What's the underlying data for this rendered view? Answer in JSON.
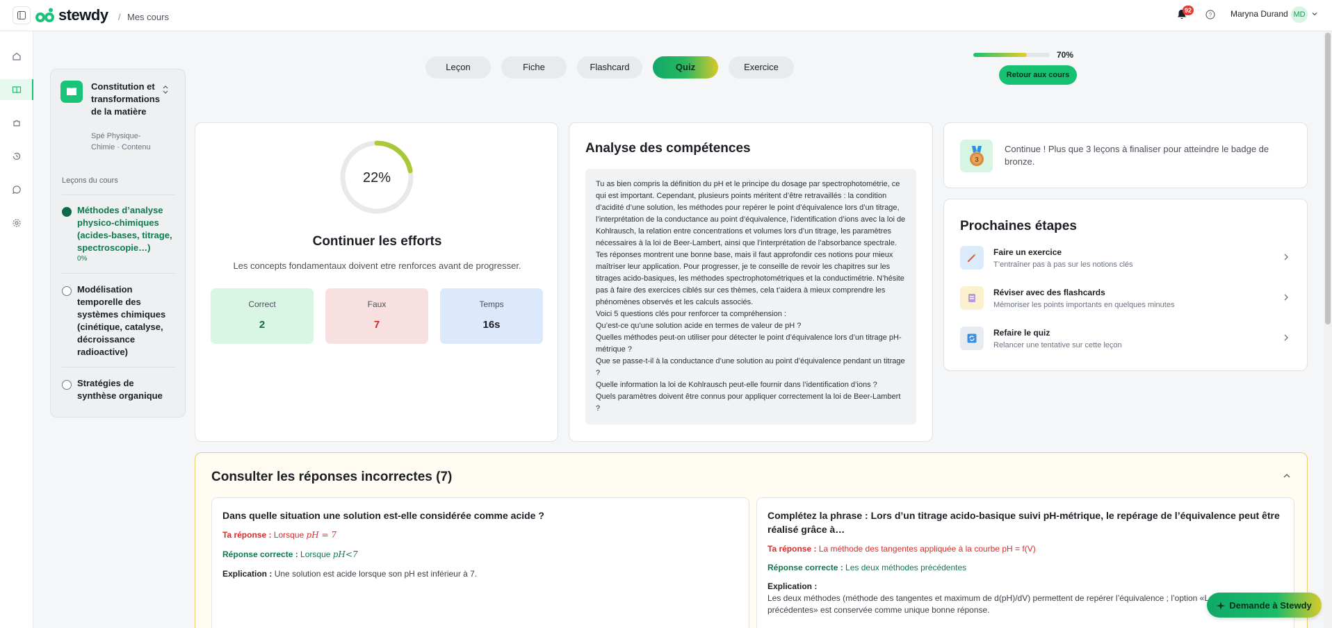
{
  "header": {
    "app_name": "stewdy",
    "breadcrumb_separator": "/",
    "breadcrumb": "Mes cours",
    "notifications_count": "92",
    "user_name": "Maryna Durand",
    "user_initials": "MD"
  },
  "rail": {
    "items": [
      "home-icon",
      "book-icon",
      "puzzle-icon",
      "history-icon",
      "chat-icon",
      "settings-icon"
    ],
    "active_index": 1
  },
  "course": {
    "title": "Constitution et transformations de la matière",
    "subtitle": "Spé Physique-Chimie · Contenu",
    "lessons_label": "Leçons du cours",
    "lessons": [
      {
        "title": "Méthodes d’analyse physico-chimiques (acides-bases, titrage, spectroscopie…)",
        "progress": "0%",
        "active": true
      },
      {
        "title": "Modélisation temporelle des systèmes chimiques (cinétique, catalyse, décroissance radioactive)",
        "active": false
      },
      {
        "title": "Stratégies de synthèse organique",
        "active": false
      }
    ]
  },
  "tabs": [
    {
      "label": "Leçon"
    },
    {
      "label": "Fiche"
    },
    {
      "label": "Flashcard"
    },
    {
      "label": "Quiz",
      "active": true
    },
    {
      "label": "Exercice"
    }
  ],
  "progress": {
    "value": 0.7,
    "label": "70%",
    "back_label": "Retour aux cours"
  },
  "score": {
    "percent_value": 0.22,
    "percent_label": "22%",
    "title": "Continuer les efforts",
    "description": "Les concepts fondamentaux doivent etre renforces avant de progresser.",
    "stats": {
      "correct_label": "Correct",
      "correct_value": "2",
      "wrong_label": "Faux",
      "wrong_value": "7",
      "time_label": "Temps",
      "time_value": "16s"
    }
  },
  "analysis": {
    "title": "Analyse des compétences",
    "paragraph": "Tu as bien compris la définition du pH et le principe du dosage par spectrophotométrie, ce qui est important. Cependant, plusieurs points méritent d’être retravaillés : la condition d’acidité d’une solution, les méthodes pour repérer le point d’équivalence lors d’un titrage, l’interprétation de la conductance au point d’équivalence, l’identification d’ions avec la loi de Kohlrausch, la relation entre concentrations et volumes lors d’un titrage, les paramètres nécessaires à la loi de Beer-Lambert, ainsi que l’interprétation de l’absorbance spectrale. Tes réponses montrent une bonne base, mais il faut approfondir ces notions pour mieux maîtriser leur application. Pour progresser, je te conseille de revoir les chapitres sur les titrages acido-basiques, les méthodes spectrophotométriques et la conductimétrie. N’hésite pas à faire des exercices ciblés sur ces thèmes, cela t’aidera à mieux comprendre les phénomènes observés et les calculs associés.",
    "questions_intro": "Voici 5 questions clés pour renforcer ta compréhension :",
    "questions": [
      "Qu’est-ce qu’une solution acide en termes de valeur de pH ?",
      "Quelles méthodes peut-on utiliser pour détecter le point d’équivalence lors d’un titrage pH-métrique ?",
      "Que se passe-t-il à la conductance d’une solution au point d’équivalence pendant un titrage ?",
      "Quelle information la loi de Kohlrausch peut-elle fournir dans l’identification d’ions ?",
      "Quels paramètres doivent être connus pour appliquer correctement la loi de Beer-Lambert ?"
    ]
  },
  "badge": {
    "text": "Continue ! Plus que 3 leçons à finaliser pour atteindre le badge de bronze.",
    "icon": "bronze-medal-icon"
  },
  "next_steps": {
    "title": "Prochaines étapes",
    "items": [
      {
        "title": "Faire un exercice",
        "subtitle": "T’entraîner pas à pas sur les notions clés",
        "icon": "pencil-icon",
        "color": "#dcebfb"
      },
      {
        "title": "Réviser avec des flashcards",
        "subtitle": "Mémoriser les points importants en quelques minutes",
        "icon": "flashcard-icon",
        "color": "#fbf1cf"
      },
      {
        "title": "Refaire le quiz",
        "subtitle": "Relancer une tentative sur cette leçon",
        "icon": "refresh-icon",
        "color": "#e7ecf2"
      }
    ]
  },
  "incorrect": {
    "title": "Consulter les réponses incorrectes (7)",
    "your_answer_label": "Ta réponse :",
    "correct_answer_label": "Réponse correcte :",
    "explanation_label": "Explication :",
    "cards": [
      {
        "question": "Dans quelle situation une solution est-elle considérée comme acide ?",
        "your_answer_text": "Lorsque ",
        "your_answer_math": "pH = 7",
        "correct_text": "Lorsque ",
        "correct_math": "pH<7",
        "explanation": "Une solution est acide lorsque son pH est inférieur à 7."
      },
      {
        "question": "Complétez la phrase : Lors d’un titrage acido-basique suivi pH-métrique, le repérage de l’équivalence peut être réalisé grâce à…",
        "your_answer_text": "La méthode des tangentes appliquée à la courbe pH = f(V)",
        "correct_text": "Les deux méthodes précédentes",
        "explanation": "Les deux méthodes (méthode des tangentes et maximum de d(pH)/dV) permettent de repérer l’équivalence ; l’option «Les deux méthodes précédentes» est conservée comme unique bonne réponse."
      }
    ]
  },
  "chat": {
    "label": "Demande à Stewdy"
  },
  "colors": {
    "brand_green": "#16c172",
    "correct": "#0e6b45",
    "wrong": "#c62828",
    "accent_yellow": "#e6cf27"
  }
}
